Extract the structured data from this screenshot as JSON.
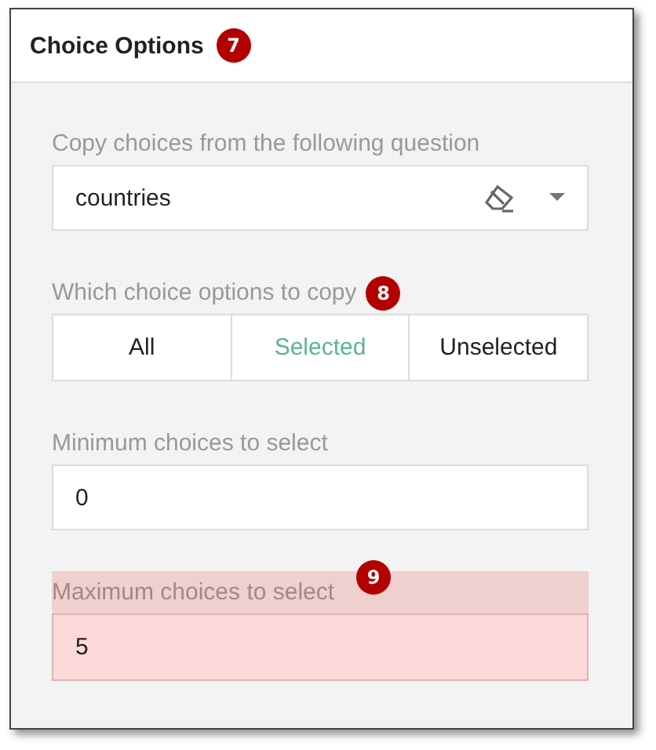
{
  "panel": {
    "title": "Choice Options",
    "badge": "7"
  },
  "fields": [
    {
      "kind": "select",
      "label": "Copy choices from the following question",
      "value": "countries"
    },
    {
      "kind": "segmented",
      "label": "Which choice options to copy",
      "badge": "8",
      "options": [
        {
          "label": "All",
          "selected": false
        },
        {
          "label": "Selected",
          "selected": true
        },
        {
          "label": "Unselected",
          "selected": false
        }
      ]
    },
    {
      "kind": "number",
      "label": "Minimum choices to select",
      "value": "0",
      "highlighted": false
    },
    {
      "kind": "number",
      "label": "Maximum choices to select",
      "value": "5",
      "badge": "9",
      "highlighted": true
    }
  ]
}
